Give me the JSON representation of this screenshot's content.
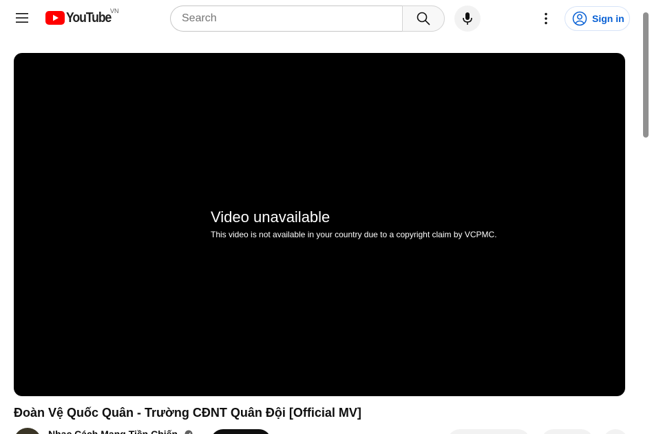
{
  "header": {
    "logo_text": "YouTube",
    "country_code": "VN",
    "search_placeholder": "Search",
    "sign_in_label": "Sign in"
  },
  "player": {
    "error_title": "Video unavailable",
    "error_message": "This video is not available in your country due to a copyright claim by VCPMC."
  },
  "video": {
    "title": "Đoàn Vệ Quốc Quân - Trường CĐNT Quân Đội [Official MV]",
    "channel_name": "Nhạc Cách Mạng Tiền Chiến"
  },
  "icons": {
    "menu": "hamburger-menu-icon",
    "logo": "youtube-play-icon",
    "search": "search-icon",
    "mic": "microphone-icon",
    "more": "more-vertical-icon",
    "account": "account-circle-icon",
    "verified": "verified-check-icon"
  },
  "colors": {
    "brand_red": "#ff0000",
    "link_blue": "#065fd4",
    "player_bg": "#000000"
  }
}
